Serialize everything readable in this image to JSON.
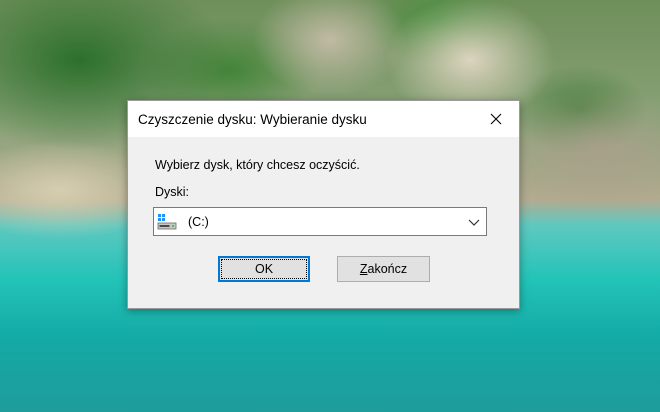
{
  "dialog": {
    "title": "Czyszczenie dysku: Wybieranie dysku",
    "close_icon": "close-icon",
    "prompt": "Wybierz dysk, który chcesz oczyścić.",
    "drives_label": "Dyski:",
    "drive_select": {
      "selected": "(C:)",
      "icon": "windows-drive-icon"
    },
    "ok_label": "OK",
    "exit_label": "Zakończ"
  },
  "colors": {
    "accent": "#0078d7",
    "dialog_bg": "#f0f0f0",
    "titlebar_bg": "#ffffff",
    "button_bg": "#e1e1e1"
  }
}
